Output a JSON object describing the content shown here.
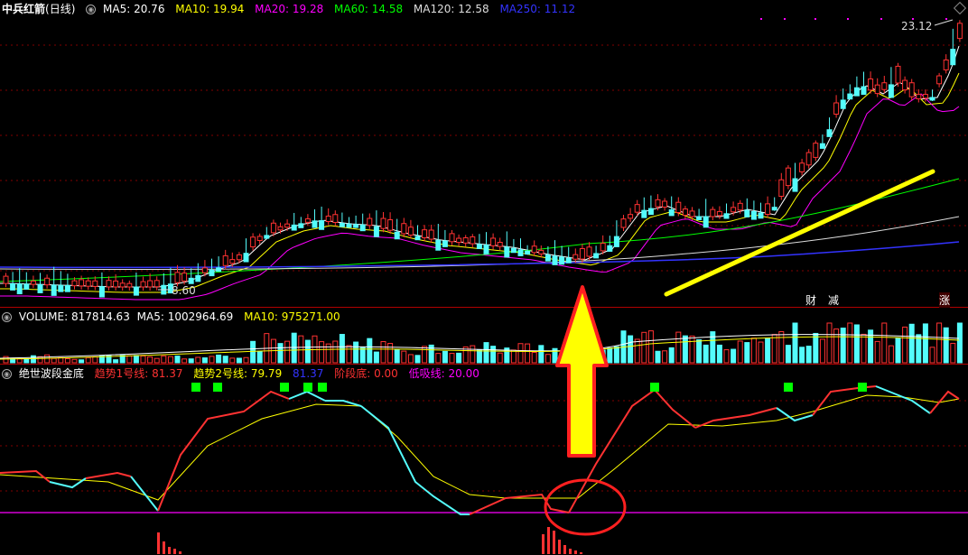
{
  "price": {
    "stock_name": "中兵红箭",
    "period": "(日线)",
    "ma": [
      {
        "label": "MA5: 20.76",
        "color": "#ffffff"
      },
      {
        "label": "MA10: 19.94",
        "color": "#ffff00"
      },
      {
        "label": "MA20: 19.28",
        "color": "#ff00ff"
      },
      {
        "label": "MA60: 14.58",
        "color": "#00ff00"
      },
      {
        "label": "MA120: 12.58",
        "color": "#dddddd"
      },
      {
        "label": "MA250: 11.12",
        "color": "#3333ff"
      }
    ],
    "high_label": "23.12",
    "low_label": "8.60",
    "markers": [
      {
        "text": "财",
        "color": "#00ffff"
      },
      {
        "text": "减",
        "color": "#00ff00"
      },
      {
        "text": "涨",
        "color": "#ff6666"
      }
    ]
  },
  "volume": {
    "name": "VOLUME",
    "value": "817814.63",
    "ma5": "MA5: 1002964.69",
    "ma10": "MA10: 975271.00"
  },
  "indicator": {
    "name": "绝世波段金底",
    "line1": "趋势1号线: 81.37",
    "line2": "趋势2号线: 79.79",
    "line3": "81.37",
    "stage_bottom": "阶段底: 0.00",
    "low_buy": "低吸线: 20.00"
  },
  "colors": {
    "up": "#ff3232",
    "down": "#54fcfc",
    "grid": "#800000",
    "annotation_yellow": "#ffff00",
    "circle_red": "#ff2020"
  }
}
